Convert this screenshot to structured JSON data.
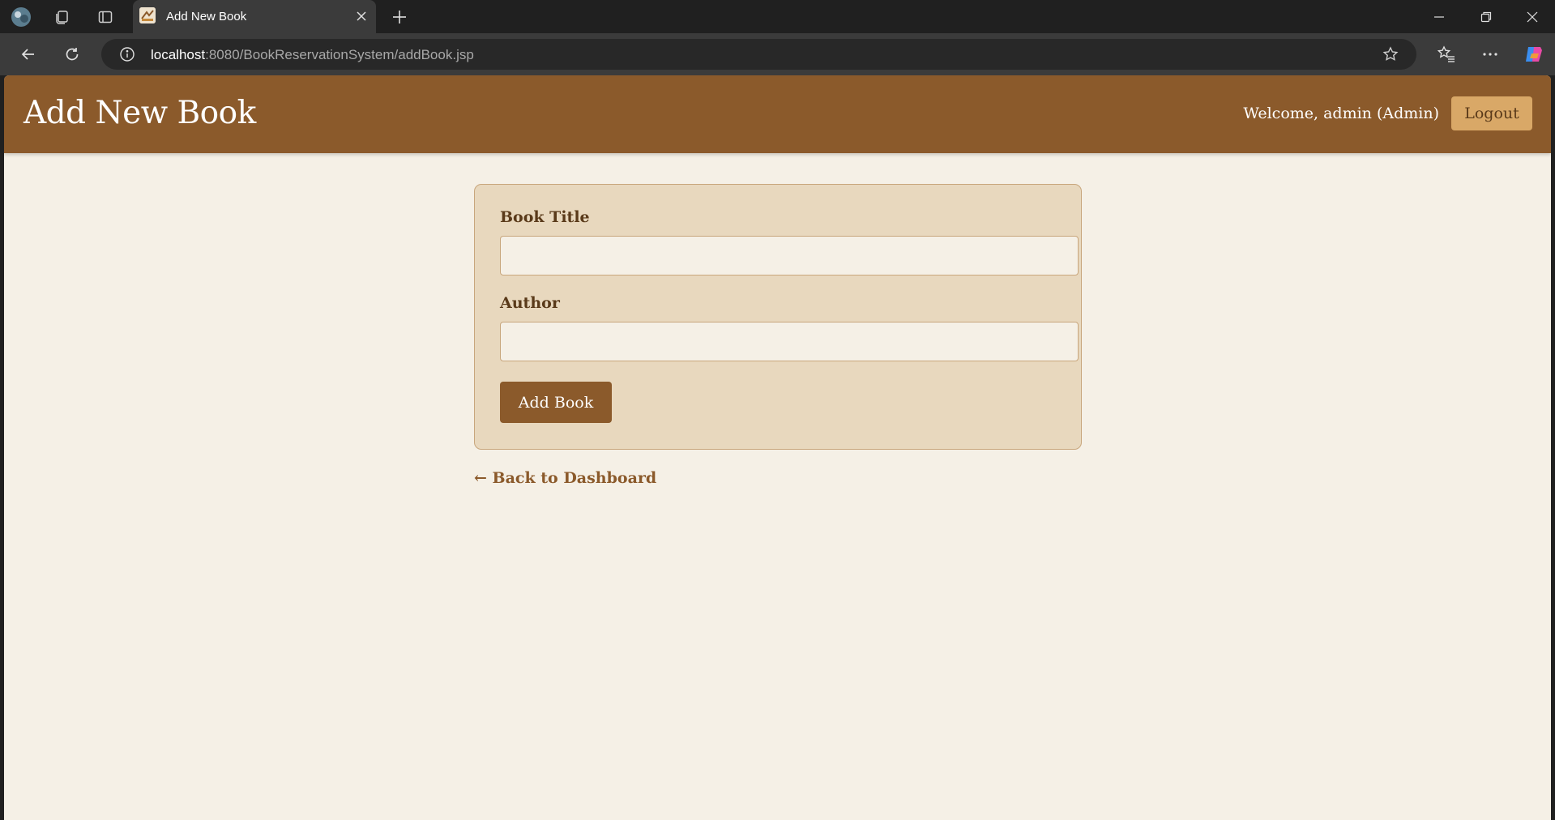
{
  "browser": {
    "tab_title": "Add New Book",
    "url_host": "localhost",
    "url_rest": ":8080/BookReservationSystem/addBook.jsp",
    "icons": [
      "profile-avatar-icon",
      "workspaces-icon",
      "tab-actions-icon",
      "close-icon",
      "plus-icon",
      "minimize-icon",
      "restore-icon",
      "window-close-icon",
      "back-arrow-icon",
      "refresh-icon",
      "info-icon",
      "star-icon",
      "favorites-icon",
      "more-icon",
      "copilot-icon"
    ]
  },
  "header": {
    "title": "Add New Book",
    "welcome": "Welcome, admin (Admin)",
    "logout_label": "Logout"
  },
  "form": {
    "title_label": "Book Title",
    "title_value": "",
    "author_label": "Author",
    "author_value": "",
    "submit_label": "Add Book"
  },
  "footer": {
    "back_link": "← Back to Dashboard"
  },
  "colors": {
    "header_bg": "#8b5a2b",
    "page_bg": "#f5f0e6",
    "card_bg": "#e8d8be",
    "logout_bg": "#d9a867",
    "text_brown": "#5a3a1a"
  }
}
